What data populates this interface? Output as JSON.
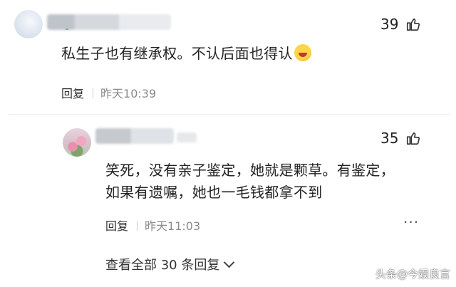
{
  "comment1": {
    "likes": "39",
    "text": "私生子也有继承权。不认后面也得认",
    "reply_label": "回复",
    "time": "昨天10:39"
  },
  "reply1": {
    "likes": "35",
    "text_line1": "笑死，没有亲子鉴定，她就是颗草。有鉴定，",
    "text_line2": "如果有遗嘱，她也一毛钱都拿不到",
    "reply_label": "回复",
    "time": "昨天11:03",
    "more": "···"
  },
  "view_all": "查看全部 30 条回复",
  "watermark": "头条@今娱良言",
  "icons": [
    "thumbs-up-icon",
    "chevron-down-icon",
    "more-icon"
  ],
  "colors": {
    "text": "#222222",
    "meta": "#8a8a8a",
    "divider": "#ececec"
  }
}
